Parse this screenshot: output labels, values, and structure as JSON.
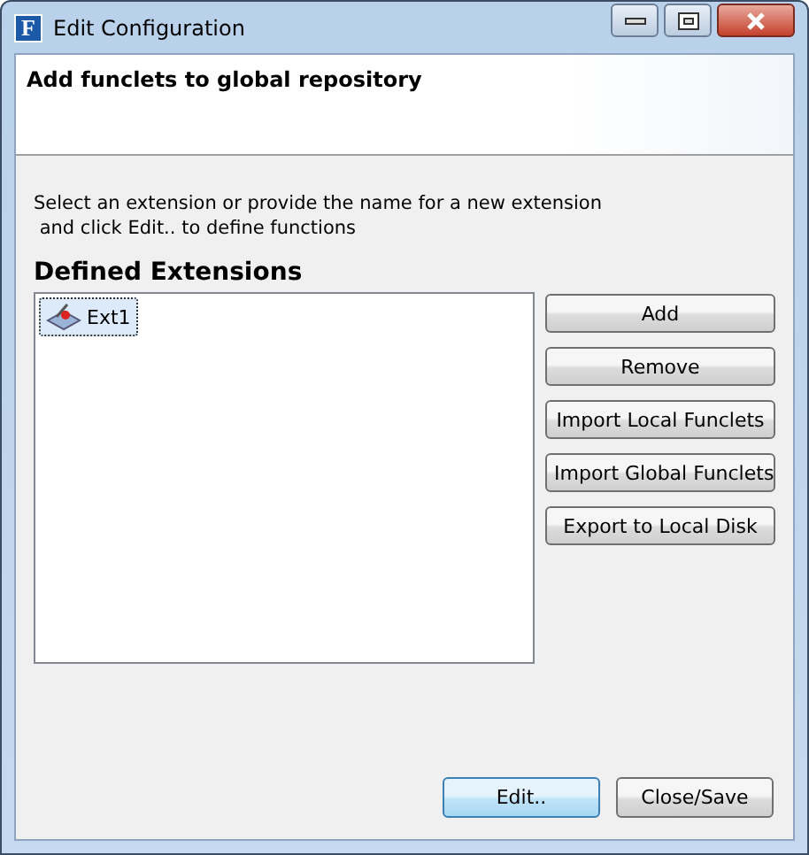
{
  "window": {
    "title": "Edit Configuration",
    "app_icon": "F"
  },
  "header": {
    "title": "Add funclets to global repository"
  },
  "instructions": [
    "Select an extension or provide the name for a new extension",
    " and click Edit.. to define functions"
  ],
  "extensions": {
    "heading": "Defined Extensions",
    "items": [
      {
        "label": "Ext1",
        "selected": true
      }
    ]
  },
  "side_buttons": [
    "Add",
    "Remove",
    "Import Local Funclets",
    "Import Global Funclets",
    "Export to Local Disk"
  ],
  "footer_buttons": [
    {
      "label": "Edit..",
      "default": true
    },
    {
      "label": "Close/Save",
      "default": false
    }
  ]
}
